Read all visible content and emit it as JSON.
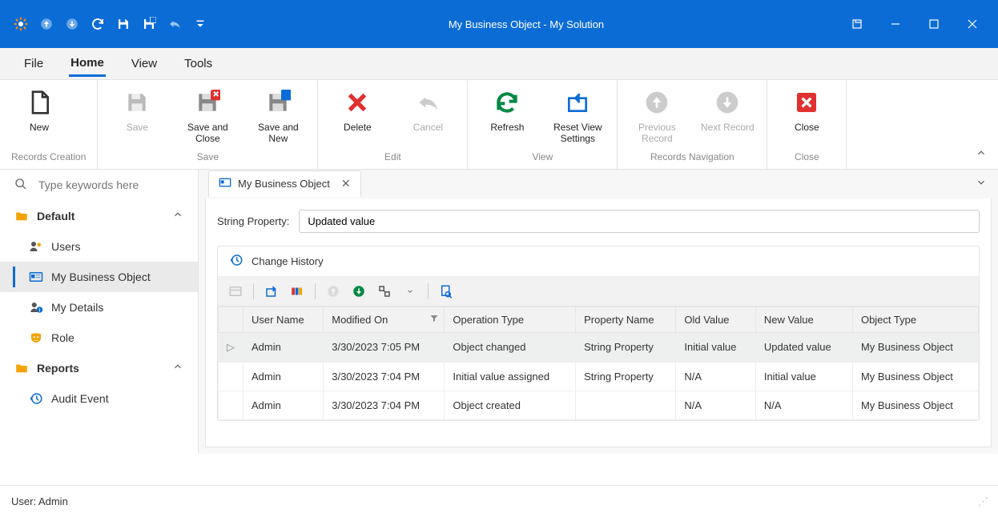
{
  "window": {
    "title": "My Business Object - My Solution"
  },
  "menubar": {
    "file": "File",
    "home": "Home",
    "view": "View",
    "tools": "Tools"
  },
  "ribbon": {
    "new": "New",
    "save": "Save",
    "saveclose": "Save and Close",
    "savenew": "Save and New",
    "delete": "Delete",
    "cancel": "Cancel",
    "refresh": "Refresh",
    "resetview": "Reset View Settings",
    "prev": "Previous Record",
    "next": "Next Record",
    "close": "Close",
    "grp_records_creation": "Records Creation",
    "grp_save": "Save",
    "grp_edit": "Edit",
    "grp_view": "View",
    "grp_nav": "Records Navigation",
    "grp_close": "Close"
  },
  "search": {
    "placeholder": "Type keywords here"
  },
  "nav": {
    "default": "Default",
    "reports": "Reports",
    "users": "Users",
    "my_biz": "My Business Object",
    "my_details": "My Details",
    "role": "Role",
    "audit": "Audit Event"
  },
  "tab": {
    "title": "My Business Object"
  },
  "prop": {
    "label": "String Property:",
    "value": "Updated value"
  },
  "history": {
    "title": "Change History",
    "cols": {
      "user": "User Name",
      "modified": "Modified On",
      "op": "Operation Type",
      "propname": "Property Name",
      "old": "Old Value",
      "new": "New Value",
      "objtype": "Object Type"
    },
    "rows": [
      {
        "user": "Admin",
        "modified": "3/30/2023 7:05 PM",
        "op": "Object changed",
        "propname": "String Property",
        "old": "Initial value",
        "new": "Updated value",
        "objtype": "My Business Object"
      },
      {
        "user": "Admin",
        "modified": "3/30/2023 7:04 PM",
        "op": "Initial value assigned",
        "propname": "String Property",
        "old": "N/A",
        "new": "Initial value",
        "objtype": "My Business Object"
      },
      {
        "user": "Admin",
        "modified": "3/30/2023 7:04 PM",
        "op": "Object created",
        "propname": "",
        "old": "N/A",
        "new": "N/A",
        "objtype": "My Business Object"
      }
    ]
  },
  "status": {
    "user": "User: Admin"
  }
}
